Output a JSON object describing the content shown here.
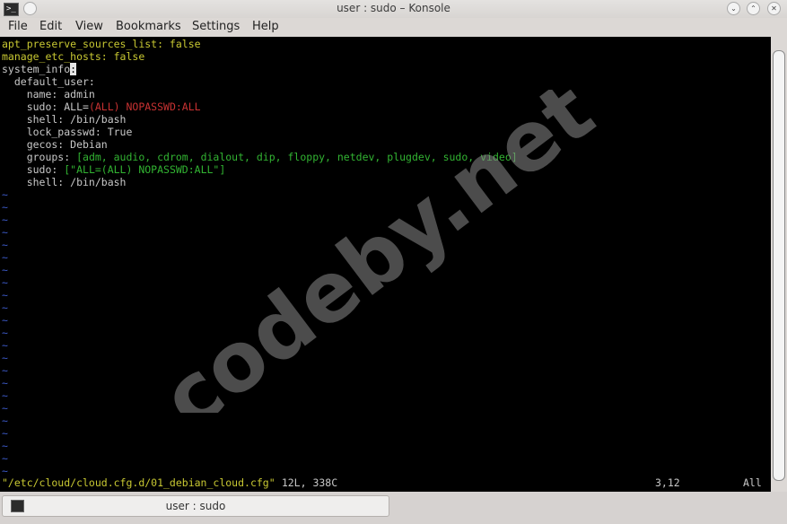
{
  "window": {
    "title": "user : sudo – Konsole",
    "app_icon": "terminal-icon",
    "left_button_icon": "window-menu-icon",
    "buttons": {
      "minimize": "⌄",
      "maximize": "⌃",
      "close": "✕"
    }
  },
  "menubar": {
    "items": [
      "File",
      "Edit",
      "View",
      "Bookmarks",
      "Settings",
      "Help"
    ]
  },
  "editor": {
    "lines": [
      [
        {
          "t": "apt_preserve_sources_list: false",
          "c": "yellow"
        }
      ],
      [
        {
          "t": "manage_etc_hosts: false",
          "c": "yellow"
        }
      ],
      [
        {
          "t": "system_info",
          "c": "white"
        },
        {
          "t": ":",
          "c": "cursor"
        }
      ],
      [
        {
          "t": "  default_user:",
          "c": "white"
        }
      ],
      [
        {
          "t": "    name: admin",
          "c": "white"
        }
      ],
      [
        {
          "t": "    sudo: ALL=",
          "c": "white"
        },
        {
          "t": "(ALL) NOPASSWD:ALL",
          "c": "red"
        }
      ],
      [
        {
          "t": "    shell: /bin/bash",
          "c": "white"
        }
      ],
      [
        {
          "t": "    lock_passwd: True",
          "c": "white"
        }
      ],
      [
        {
          "t": "    gecos: Debian",
          "c": "white"
        }
      ],
      [
        {
          "t": "    groups: ",
          "c": "white"
        },
        {
          "t": "[adm, audio, cdrom, dialout, dip, floppy, netdev, plugdev, sudo, video]",
          "c": "green"
        }
      ],
      [
        {
          "t": "    sudo: ",
          "c": "white"
        },
        {
          "t": "[\"ALL=(ALL) NOPASSWD:ALL\"]",
          "c": "green"
        }
      ],
      [
        {
          "t": "    shell: /bin/bash",
          "c": "white"
        }
      ]
    ],
    "tilde": "~",
    "tilde_count": 23,
    "status": {
      "file": "\"/etc/cloud/cloud.cfg.d/01_debian_cloud.cfg\"",
      "info": " 12L, 338C",
      "position": "3,12",
      "scroll": "All"
    }
  },
  "watermark": {
    "text": "codeby.net"
  },
  "tabs": [
    {
      "label": "user : sudo",
      "icon": "terminal-icon"
    }
  ]
}
